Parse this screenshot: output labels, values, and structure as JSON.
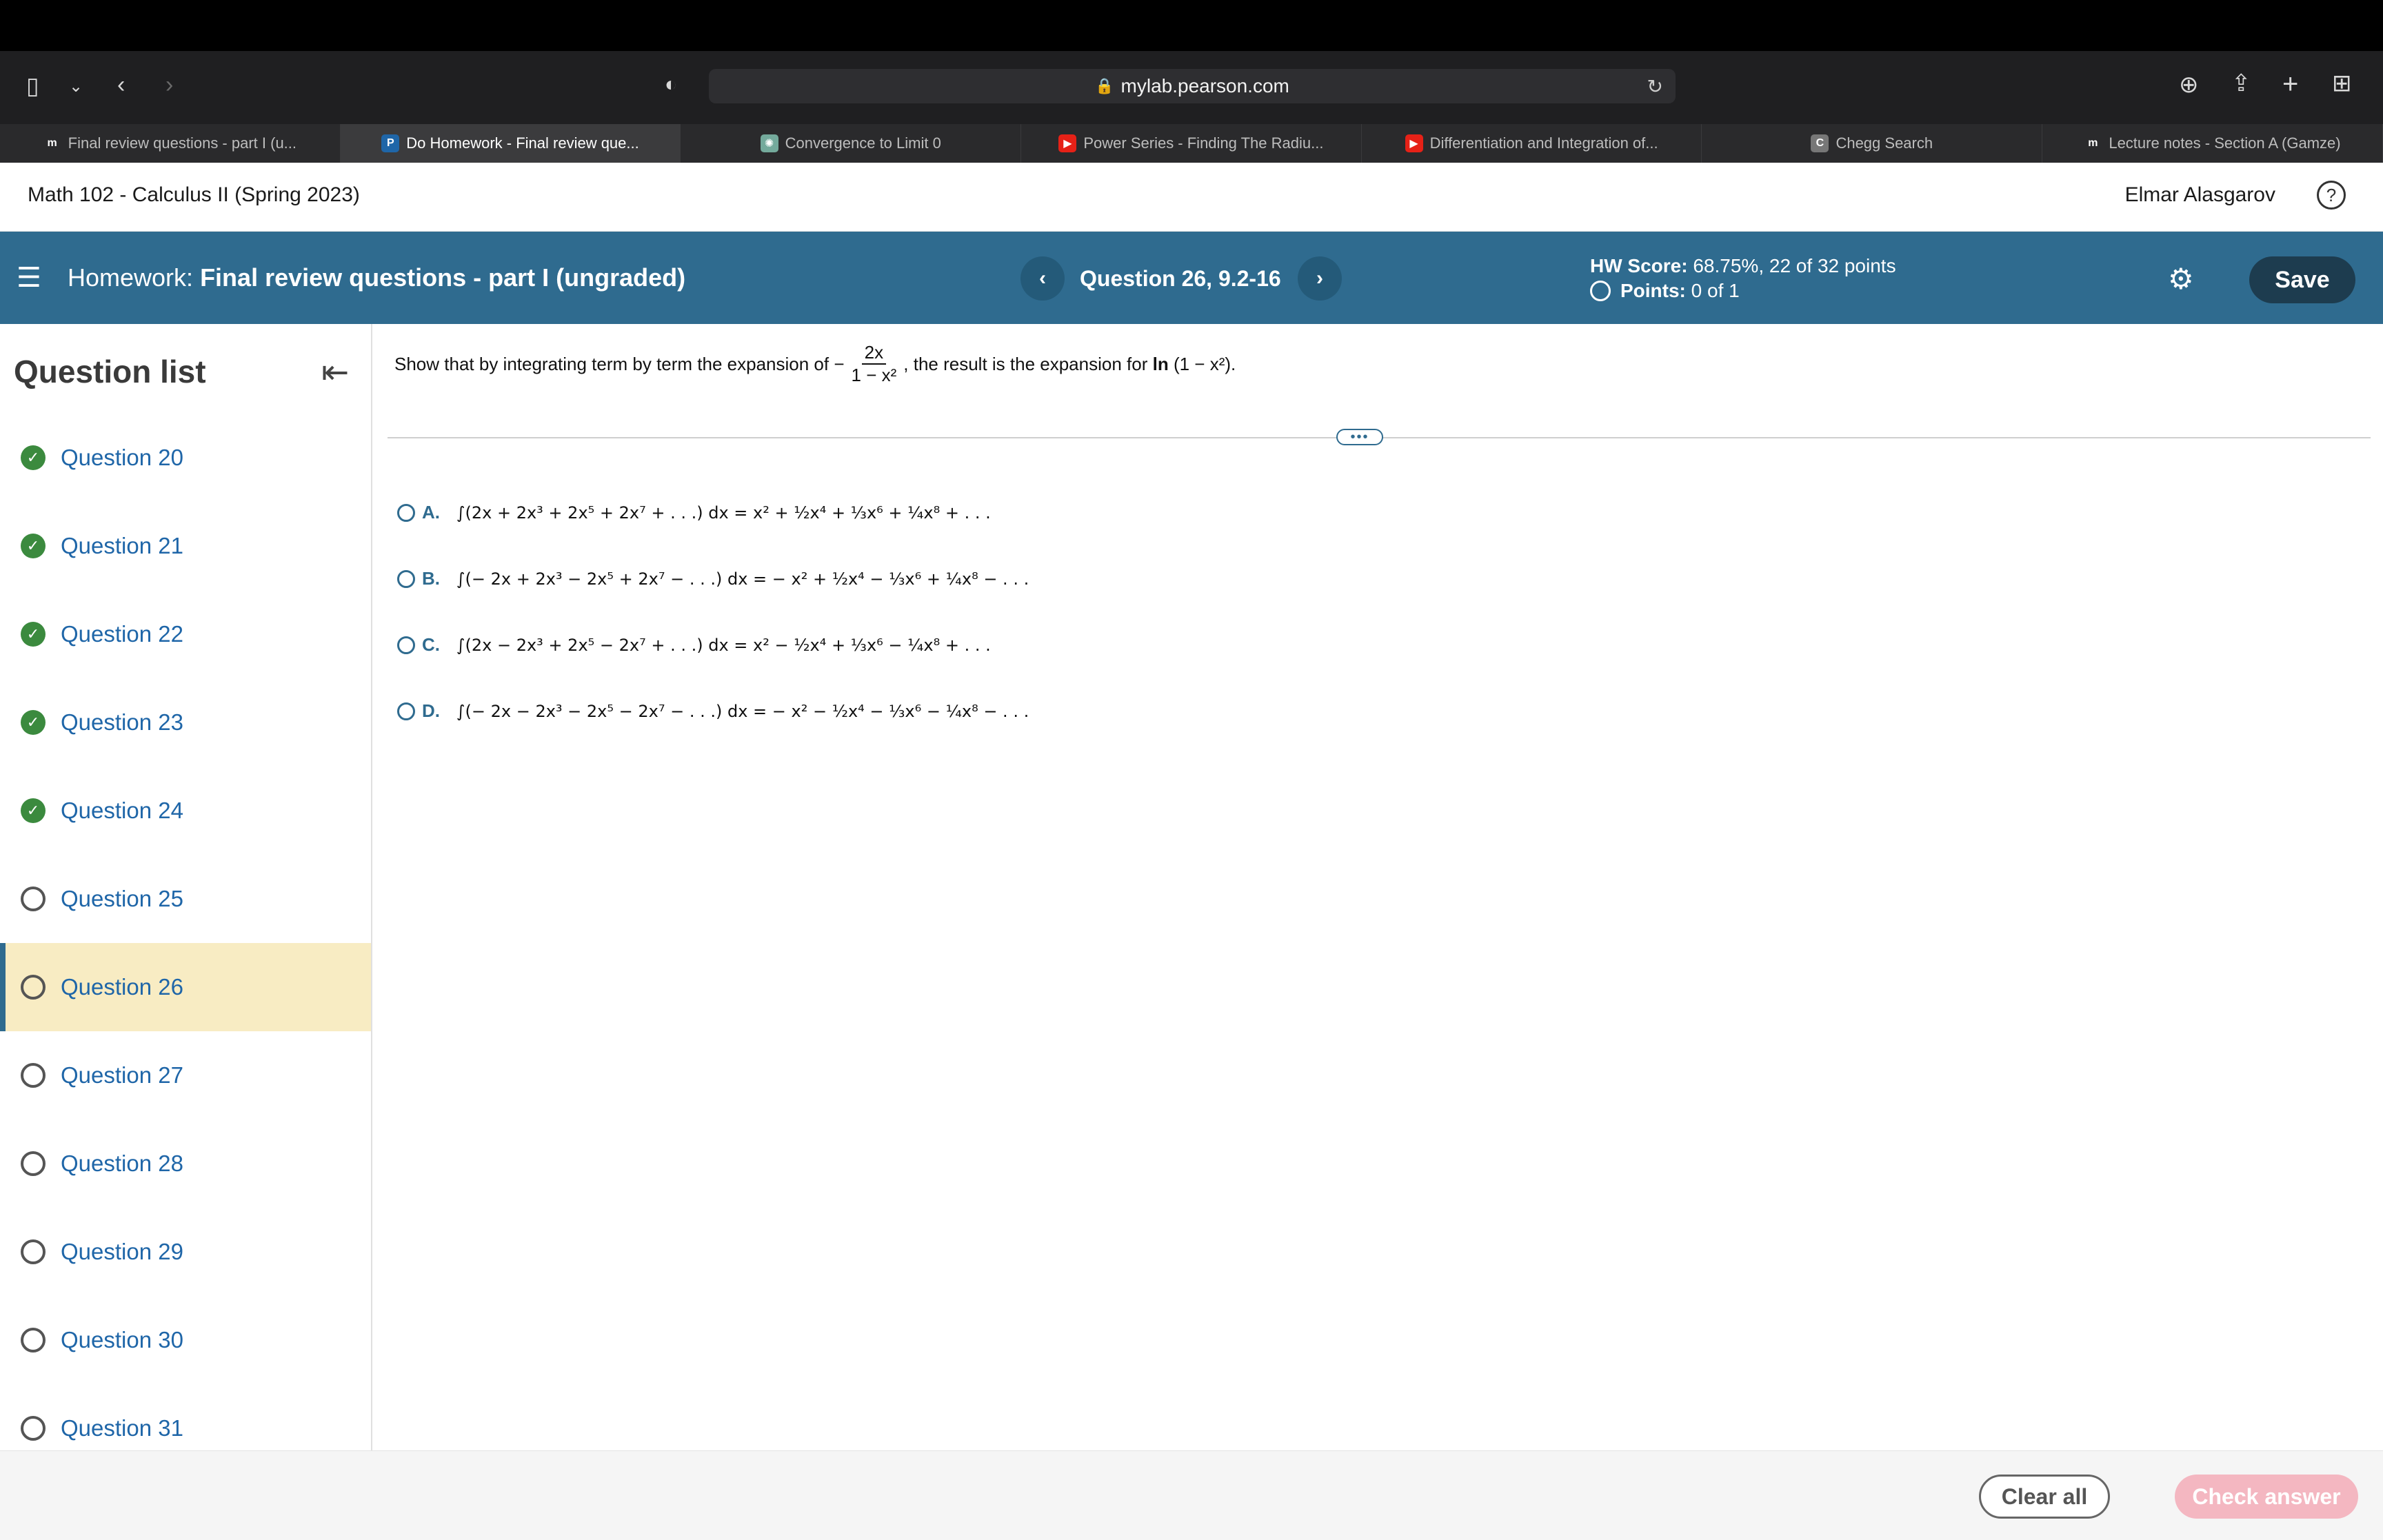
{
  "browser": {
    "url": "mylab.pearson.com",
    "tabs": [
      {
        "label": "Final review questions - part I (u...",
        "icon": "pearson-mathxl-icon",
        "color": "#2a2a2c"
      },
      {
        "label": "Do Homework - Final review que...",
        "icon": "pearson-p-icon",
        "color": "#1f66a8"
      },
      {
        "label": "Convergence to Limit 0",
        "icon": "openai-icon",
        "color": "#74aa9c"
      },
      {
        "label": "Power Series - Finding The Radiu...",
        "icon": "youtube-icon",
        "color": "#e62117"
      },
      {
        "label": "Differentiation and Integration of...",
        "icon": "youtube-icon",
        "color": "#e62117"
      },
      {
        "label": "Chegg Search",
        "icon": "chegg-icon",
        "color": "#777777"
      },
      {
        "label": "Lecture notes - Section A (Gamze)",
        "icon": "pearson-mathxl-icon",
        "color": "#2a2a2c"
      }
    ]
  },
  "course": {
    "title": "Math 102 - Calculus II (Spring 2023)",
    "user": "Elmar Alasgarov"
  },
  "homework": {
    "prefix": "Homework:",
    "name": "Final review questions - part I (ungraded)",
    "question": "Question 26, 9.2-16",
    "score_label": "HW Score:",
    "score_value": "68.75%, 22 of 32 points",
    "points_label": "Points:",
    "points_value": "0 of 1",
    "save_label": "Save"
  },
  "sidebar": {
    "title": "Question list",
    "items": [
      {
        "label": "Question 20",
        "status": "done"
      },
      {
        "label": "Question 21",
        "status": "done"
      },
      {
        "label": "Question 22",
        "status": "done"
      },
      {
        "label": "Question 23",
        "status": "done"
      },
      {
        "label": "Question 24",
        "status": "done"
      },
      {
        "label": "Question 25",
        "status": "open"
      },
      {
        "label": "Question 26",
        "status": "current"
      },
      {
        "label": "Question 27",
        "status": "open"
      },
      {
        "label": "Question 28",
        "status": "open"
      },
      {
        "label": "Question 29",
        "status": "open"
      },
      {
        "label": "Question 30",
        "status": "open"
      },
      {
        "label": "Question 31",
        "status": "open"
      }
    ]
  },
  "question": {
    "prompt_start": "Show that by integrating term by term the expansion of −",
    "frac_num": "2x",
    "frac_den": "1 − x²",
    "prompt_mid": ", the result is the expansion for",
    "ln": "ln",
    "ln_arg": "(1 − x²).",
    "options": [
      {
        "letter": "A.",
        "expr": "∫(2x + 2x³ + 2x⁵ + 2x⁷ + . . .) dx = x² + ½x⁴ + ⅓x⁶ + ¼x⁸ + . . ."
      },
      {
        "letter": "B.",
        "expr": "∫(− 2x + 2x³ − 2x⁵ + 2x⁷ − . . .) dx = − x² + ½x⁴ − ⅓x⁶ + ¼x⁸ − . . ."
      },
      {
        "letter": "C.",
        "expr": "∫(2x − 2x³ + 2x⁵ − 2x⁷ + . . .) dx = x² − ½x⁴ + ⅓x⁶ − ¼x⁸ + . . ."
      },
      {
        "letter": "D.",
        "expr": "∫(− 2x − 2x³ − 2x⁵ − 2x⁷ − . . .) dx = − x² − ½x⁴ − ⅓x⁶ − ¼x⁸ − . . ."
      }
    ]
  },
  "footer": {
    "clear_label": "Clear all",
    "check_label": "Check answer"
  }
}
